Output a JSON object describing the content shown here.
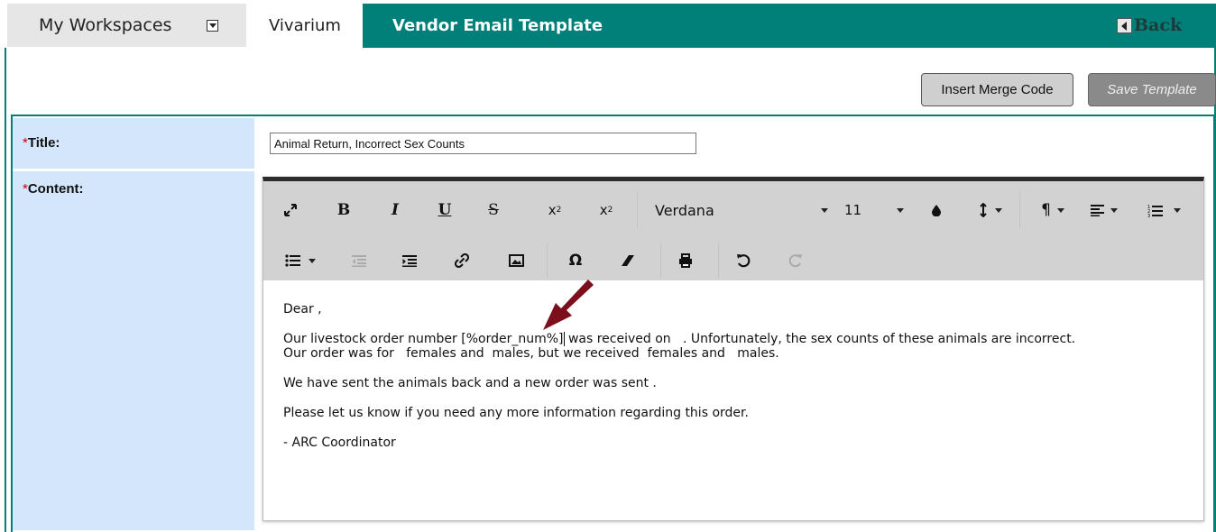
{
  "nav": {
    "workspaces_label": "My Workspaces",
    "vivarium_label": "Vivarium",
    "page_title": "Vendor Email Template",
    "back_label": "Back"
  },
  "actions": {
    "insert_merge_code": "Insert Merge Code",
    "save_template": "Save Template"
  },
  "form": {
    "required_marker": "*",
    "title_label": "Title:",
    "title_value": "Animal Return, Incorrect Sex Counts",
    "content_label": "Content:"
  },
  "editor": {
    "toolbar": {
      "font_name": "Verdana",
      "font_size": "11"
    },
    "content": {
      "line1": "Dear ,",
      "line2a": "Our livestock order number [%order_num%]",
      "line2b": " was received on   . Unfortunately, the sex counts of these animals are incorrect.",
      "line3": "Our order was for   females and  males, but we received  females and   males.",
      "line4": "We have sent the animals back and a new order was sent .",
      "line5": "Please let us know if you need any more information regarding this order.",
      "line6": "- ARC Coordinator"
    }
  },
  "colors": {
    "teal": "#008079",
    "label_bg": "#d3e6fb",
    "arrow": "#7b0f1c"
  }
}
